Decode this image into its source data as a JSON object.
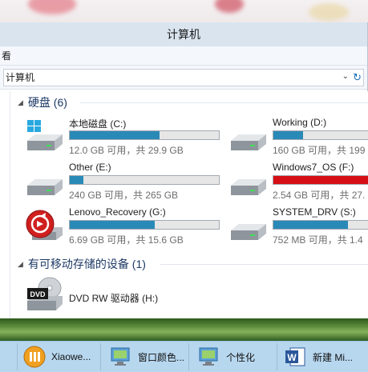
{
  "window": {
    "title": "计算机",
    "ribbon_tab": "看",
    "address": "计算机"
  },
  "groups": {
    "hard_disks": "硬盘 (6)",
    "removable": "有可移动存储的设备 (1)"
  },
  "drives": [
    {
      "name": "本地磁盘 (C:)",
      "info": "12.0 GB 可用，共 29.9 GB",
      "used_fraction": 0.6,
      "critical": false,
      "icon": "windows-drive-icon"
    },
    {
      "name": "Working (D:)",
      "info": "160 GB 可用，共 199",
      "used_fraction": 0.2,
      "critical": false,
      "icon": "hard-drive-icon"
    },
    {
      "name": "Other (E:)",
      "info": "240 GB 可用，共 265 GB",
      "used_fraction": 0.09,
      "critical": false,
      "icon": "hard-drive-icon"
    },
    {
      "name": "Windows7_OS (F:)",
      "info": "2.54 GB 可用，共 27.",
      "used_fraction": 0.91,
      "critical": true,
      "icon": "hard-drive-icon"
    },
    {
      "name": "Lenovo_Recovery (G:)",
      "info": "6.69 GB 可用，共 15.6 GB",
      "used_fraction": 0.57,
      "critical": false,
      "icon": "recovery-drive-icon"
    },
    {
      "name": "SYSTEM_DRV (S:)",
      "info": "752 MB 可用，共 1.4",
      "used_fraction": 0.5,
      "critical": false,
      "icon": "hard-drive-icon"
    }
  ],
  "dvd": {
    "name": "DVD RW 驱动器 (H:)",
    "icon": "dvd-drive-icon",
    "badge": "DVD"
  },
  "taskbar": [
    {
      "label": "",
      "icon": "taskbar-edge"
    },
    {
      "label": "Xiaowe...",
      "icon": "xiaowei-app-icon"
    },
    {
      "label": "窗口颜色...",
      "icon": "control-panel-icon"
    },
    {
      "label": "个性化",
      "icon": "control-panel-icon"
    },
    {
      "label": "新建 Mi...",
      "icon": "word-icon",
      "glyph": "W"
    }
  ],
  "colors": {
    "bar_normal": "#2a8ab7",
    "bar_critical": "#d60f16",
    "titlebar": "#d9e4ef",
    "taskbar": "#b7d7ef"
  }
}
